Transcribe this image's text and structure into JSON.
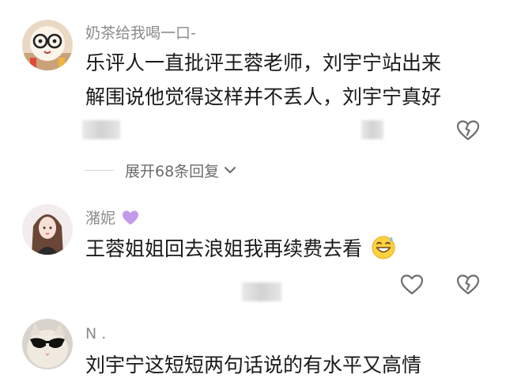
{
  "comments": [
    {
      "username": "奶茶给我喝一口-",
      "lines": [
        "乐评人一直批评王蓉老师，刘宇宁站出来",
        "解围说他觉得这样并不丢人，刘宇宁真好"
      ],
      "avatar": "glasses-cartoon-avatar"
    },
    {
      "username": "潴妮",
      "username_emoji": "purple-heart-icon",
      "text": "王蓉姐姐回去浪姐我再续费去看",
      "text_emoji": "sweat-smile-emoji-icon",
      "avatar": "girl-portrait-avatar"
    },
    {
      "username": "N .",
      "text": "刘宇宁这短短两句话说的有水平又高情",
      "avatar": "sunglasses-cat-avatar"
    }
  ],
  "replies": {
    "label": "展开68条回复"
  },
  "colors": {
    "username": "#8c8c8c",
    "text": "#1a1a1a",
    "icon": "#6e6e6e",
    "heart_purple": "#c39bea"
  }
}
